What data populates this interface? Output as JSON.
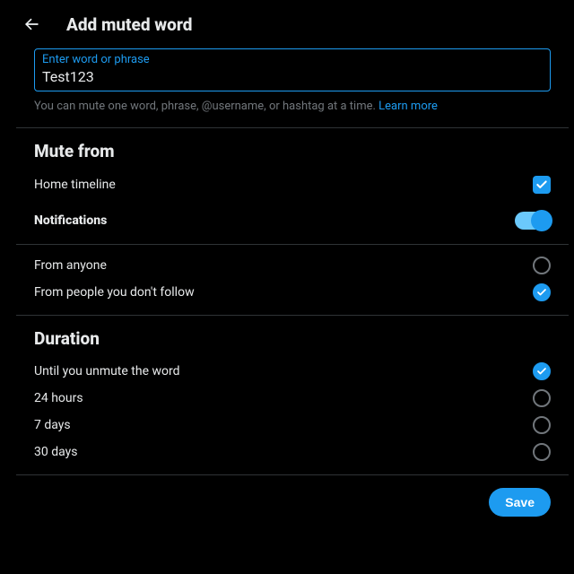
{
  "header": {
    "title": "Add muted word"
  },
  "input": {
    "label": "Enter word or phrase",
    "value": "Test123"
  },
  "helper": {
    "text": "You can mute one word, phrase, @username, or hashtag at a time. ",
    "link": "Learn more"
  },
  "muteFrom": {
    "title": "Mute from",
    "homeTimeline": {
      "label": "Home timeline",
      "checked": true
    },
    "notifications": {
      "label": "Notifications",
      "enabled": true
    },
    "scope": [
      {
        "label": "From anyone",
        "selected": false
      },
      {
        "label": "From people you don't follow",
        "selected": true
      }
    ]
  },
  "duration": {
    "title": "Duration",
    "options": [
      {
        "label": "Until you unmute the word",
        "selected": true
      },
      {
        "label": "24 hours",
        "selected": false
      },
      {
        "label": "7 days",
        "selected": false
      },
      {
        "label": "30 days",
        "selected": false
      }
    ]
  },
  "footer": {
    "save": "Save"
  }
}
